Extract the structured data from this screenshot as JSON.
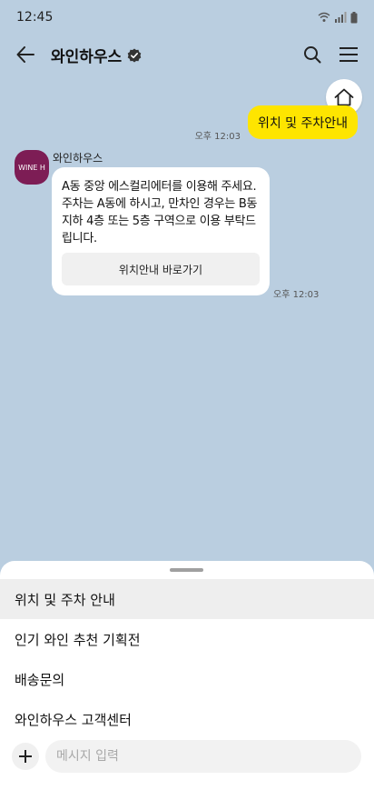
{
  "status_bar": {
    "time": "12:45"
  },
  "header": {
    "title": "와인하우스",
    "verified_icon": "verified-badge-icon"
  },
  "messages": {
    "user": {
      "text": "위치 및 주차안내",
      "time": "오후 12:03"
    },
    "bot": {
      "name": "와인하우스",
      "avatar_text": "WINE H",
      "text": "A동 중앙 에스컬리에터를 이용해 주세요. 주차는 A동에 하시고, 만차인 경우는 B동 지하 4층 또는 5층 구역으로 이용 부탁드립니다.",
      "link_button": "위치안내 바로가기",
      "time": "오후 12:03"
    }
  },
  "quick_menu": {
    "items": [
      {
        "label": "위치 및 주차 안내",
        "selected": true
      },
      {
        "label": "인기 와인 추천 기획전",
        "selected": false
      },
      {
        "label": "배송문의",
        "selected": false
      },
      {
        "label": "와인하우스 고객센터",
        "selected": false
      }
    ]
  },
  "input": {
    "placeholder": "메시지 입력",
    "value": ""
  },
  "colors": {
    "chat_background": "#bacee0",
    "user_bubble": "#fee500",
    "bot_avatar": "#7d1d55",
    "selected_item": "#eeeeee"
  }
}
